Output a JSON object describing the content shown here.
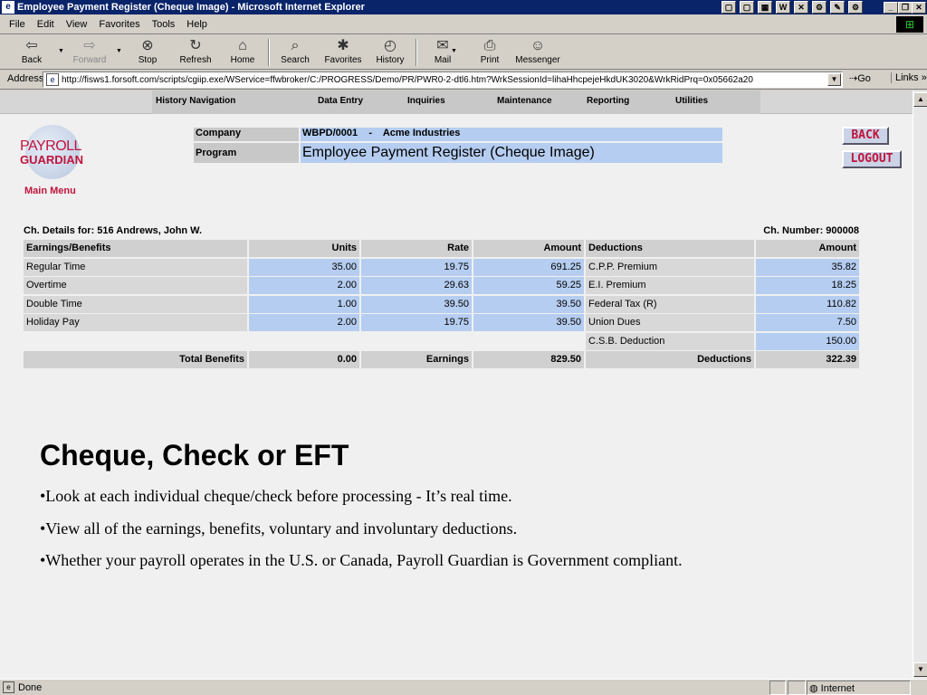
{
  "window": {
    "title": "Employee Payment Register (Cheque Image) - Microsoft Internet Explorer"
  },
  "menu": [
    "File",
    "Edit",
    "View",
    "Favorites",
    "Tools",
    "Help"
  ],
  "toolbar": {
    "back": "Back",
    "forward": "Forward",
    "stop": "Stop",
    "refresh": "Refresh",
    "home": "Home",
    "search": "Search",
    "favorites": "Favorites",
    "history": "History",
    "mail": "Mail",
    "print": "Print",
    "messenger": "Messenger"
  },
  "address": {
    "label": "Address",
    "url": "http://fisws1.forsoft.com/scripts/cgiip.exe/WService=ffwbroker/C:/PROGRESS/Demo/PR/PWR0-2-dtl6.htm?WrkSessionId=lihaHhcpejeHkdUK3020&WrkRidPrq=0x05662a20",
    "go": "Go",
    "links": "Links"
  },
  "nav": [
    "History Navigation",
    "Data Entry",
    "Inquiries",
    "Maintenance",
    "Reporting",
    "Utilities"
  ],
  "logo": {
    "line1": "PAYROLL",
    "line2": "GUARDIAN",
    "main_menu": "Main Menu"
  },
  "header": {
    "company_label": "Company",
    "company_value": "WBPD/0001    -    Acme Industries",
    "program_label": "Program",
    "program_value": "Employee Payment Register (Cheque Image)"
  },
  "buttons": {
    "back": "BACK",
    "logout": "LOGOUT"
  },
  "register": {
    "details_for": "Ch. Details for: 516 Andrews, John W.",
    "cheque_number": "Ch. Number: 900008",
    "earn_headers": [
      "Earnings/Benefits",
      "Units",
      "Rate",
      "Amount"
    ],
    "ded_headers": [
      "Deductions",
      "Amount"
    ],
    "earnings": [
      {
        "name": "Regular Time",
        "units": "35.00",
        "rate": "19.75",
        "amount": "691.25"
      },
      {
        "name": "Overtime",
        "units": "2.00",
        "rate": "29.63",
        "amount": "59.25"
      },
      {
        "name": "Double Time",
        "units": "1.00",
        "rate": "39.50",
        "amount": "39.50"
      },
      {
        "name": "Holiday Pay",
        "units": "2.00",
        "rate": "19.75",
        "amount": "39.50"
      }
    ],
    "deductions": [
      {
        "name": "C.P.P. Premium",
        "amount": "35.82"
      },
      {
        "name": "E.I. Premium",
        "amount": "18.25"
      },
      {
        "name": "Federal Tax (R)",
        "amount": "110.82"
      },
      {
        "name": "Union Dues",
        "amount": "7.50"
      },
      {
        "name": "C.S.B. Deduction",
        "amount": "150.00"
      }
    ],
    "totals": {
      "benefits_label": "Total Benefits",
      "benefits_value": "0.00",
      "earnings_label": "Earnings",
      "earnings_value": "829.50",
      "deductions_label": "Deductions",
      "deductions_value": "322.39"
    }
  },
  "slide": {
    "title": "Cheque, Check or EFT",
    "bullets": [
      "•Look at each individual cheque/check before processing - It’s real time.",
      "•View all of the earnings, benefits, voluntary and involuntary deductions.",
      "•Whether your payroll operates in the  U.S. or Canada, Payroll Guardian is Government compliant."
    ]
  },
  "status": {
    "text": "Done",
    "zone": "Internet"
  }
}
